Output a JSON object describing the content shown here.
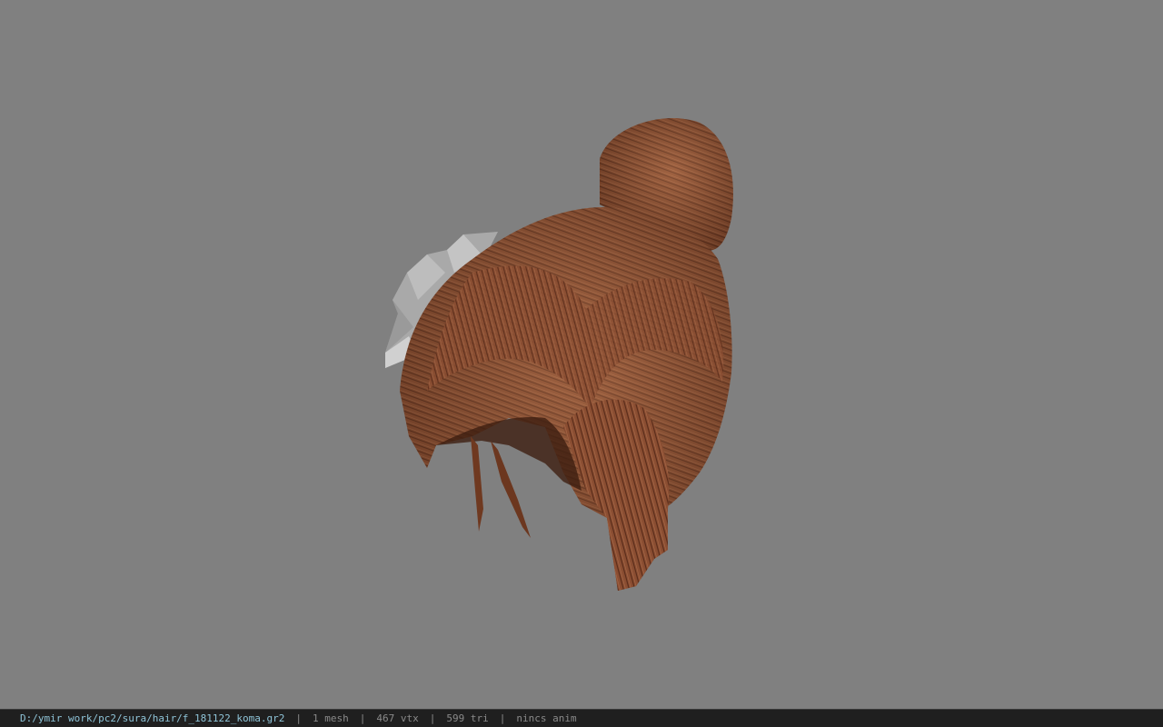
{
  "viewport": {
    "background": "#808080",
    "model_name": "hair mesh"
  },
  "statusbar": {
    "file_path": "D:/ymir work/pc2/sura/hair/f_181122_koma.gr2",
    "separator": "|",
    "mesh_count": "1 mesh",
    "vertex_count": "467 vtx",
    "triangle_count": "599 tri",
    "anim_status": "nincs anim",
    "path_color": "#8fc4d8"
  }
}
